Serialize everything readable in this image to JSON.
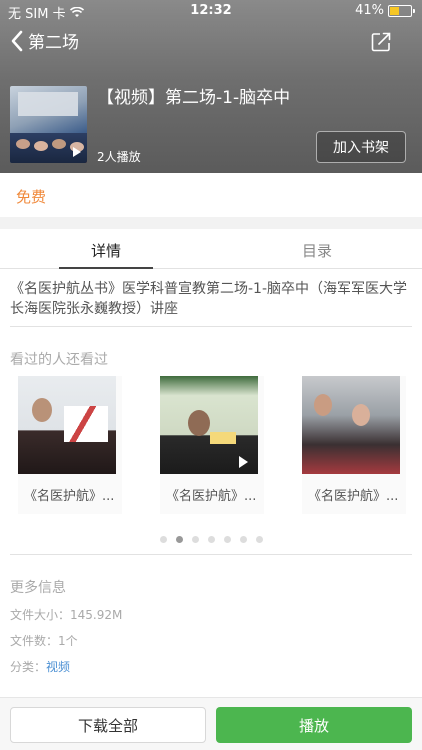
{
  "status_bar": {
    "carrier": "无 SIM 卡",
    "time": "12:32",
    "battery_text": "41%",
    "battery_level": 0.41,
    "battery_color": "#f6c624"
  },
  "nav": {
    "back_icon": "chevron-left-icon",
    "title": "第二场",
    "share_icon": "share-icon"
  },
  "video": {
    "title": "【视频】第二场-1-脑卒中",
    "plays": "2人播放",
    "add_shelf": "加入书架"
  },
  "price": {
    "label": "免费",
    "color": "#f08a3c"
  },
  "tabs": [
    {
      "label": "详情",
      "active": true
    },
    {
      "label": "目录",
      "active": false
    }
  ],
  "description": "《名医护航丛书》医学科普宣教第二场-1-脑卒中（海军军医大学长海医院张永巍教授）讲座",
  "related": {
    "title": "看过的人还看过",
    "items": [
      {
        "caption": "《名医护航》..."
      },
      {
        "caption": "《名医护航》..."
      },
      {
        "caption": "《名医护航》..."
      }
    ],
    "page_count": 7,
    "active_page": 1
  },
  "more_info": {
    "title": "更多信息",
    "file_size_label": "文件大小：",
    "file_size": "145.92M",
    "file_count_label": "文件数：",
    "file_count": "1个",
    "category_label": "分类：",
    "category": "视频",
    "link_color": "#4a8fd3"
  },
  "bottom": {
    "download_all": "下载全部",
    "play": "播放",
    "play_color": "#4cb64f"
  }
}
